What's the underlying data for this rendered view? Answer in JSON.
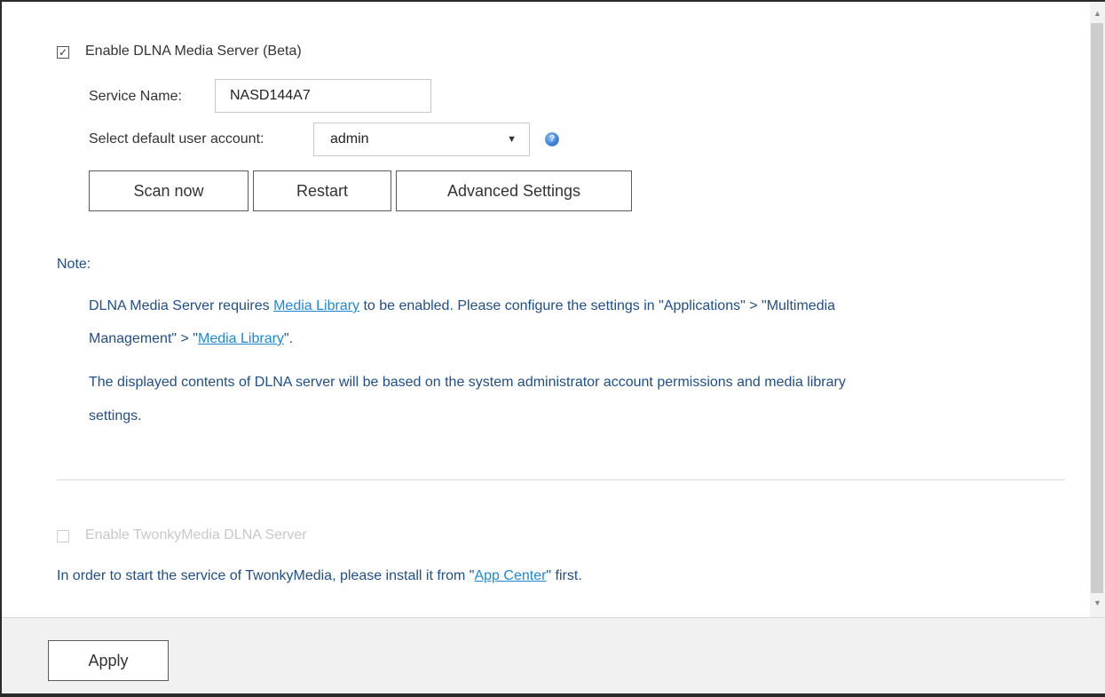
{
  "dlna": {
    "enable_checked": true,
    "enable_label": "Enable DLNA Media Server (Beta)",
    "service_name_label": "Service Name:",
    "service_name_value": "NASD144A7",
    "user_account_label": "Select default user account:",
    "user_account_value": "admin",
    "help_glyph": "?",
    "buttons": {
      "scan": "Scan now",
      "restart": "Restart",
      "advanced": "Advanced Settings"
    }
  },
  "note": {
    "title": "Note:",
    "line1": {
      "pre": "DLNA Media Server requires ",
      "link": "Media Library",
      "post": " to be enabled. Please configure the settings in \"Applications\" > \"Multimedia"
    },
    "line2": {
      "pre": "Management\" > \"",
      "link": "Media Library",
      "post": "\"."
    },
    "line3": "The displayed contents of DLNA server will be based on the system administrator account permissions and media library",
    "line4": "settings."
  },
  "twonky": {
    "enable_checked": false,
    "enable_label": "Enable TwonkyMedia DLNA Server",
    "install_pre": "In order to start the service of TwonkyMedia, please install it from \"",
    "install_link": "App Center",
    "install_post": "\" first."
  },
  "footer": {
    "apply_label": "Apply"
  },
  "scrollbar": {
    "up_glyph": "▲",
    "down_glyph": "▼"
  },
  "glyphs": {
    "check": "✓",
    "dropdown": "▼"
  },
  "colors": {
    "note_text": "#1f4e88",
    "link": "#1e88d8",
    "disabled": "#c8c8c8"
  }
}
